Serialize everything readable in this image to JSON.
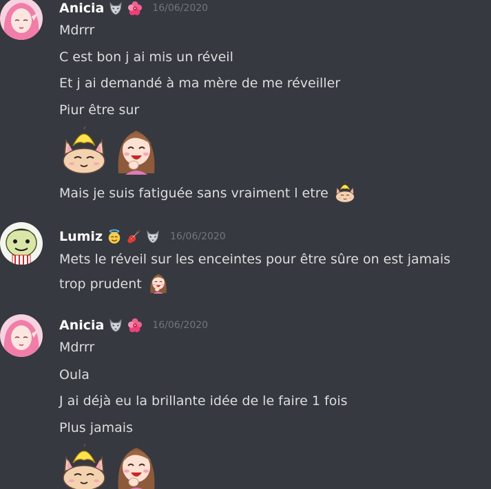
{
  "groups": [
    {
      "username": "Anicia",
      "timestamp": "16/06/2020",
      "badges": [
        "wolf-icon",
        "hibiscus-icon"
      ],
      "messages": [
        "Mdrrr",
        "C est bon j ai mis un réveil",
        "Et j ai demandé à ma mère de me réveiller",
        "Piur être sur"
      ],
      "big_emojis": [
        "banana-cat-emoji",
        "laughing-girl-emoji"
      ],
      "after_message": "Mais je suis fatiguée sans vraiment l etre",
      "after_emoji": "banana-cat-emoji"
    },
    {
      "username": "Lumiz",
      "timestamp": "16/06/2020",
      "badges": [
        "innocent-face-icon",
        "guitar-icon",
        "wolf-icon"
      ],
      "messages": [
        "Mets le réveil sur les enceintes pour être sûre on est jamais",
        "trop prudent"
      ],
      "trailing_emoji": "laughing-girl-emoji"
    },
    {
      "username": "Anicia",
      "timestamp": "16/06/2020",
      "badges": [
        "wolf-icon",
        "hibiscus-icon"
      ],
      "messages": [
        "Mdrrr",
        "Oula",
        "J ai déjà eu la brillante idée de le faire 1 fois",
        "Plus jamais"
      ],
      "big_emojis": [
        "banana-cat-emoji",
        "laughing-girl-emoji"
      ]
    }
  ],
  "colors": {
    "background": "#36393f",
    "username": "#ffffff",
    "message_text": "#dcddde",
    "timestamp": "#72767d"
  }
}
